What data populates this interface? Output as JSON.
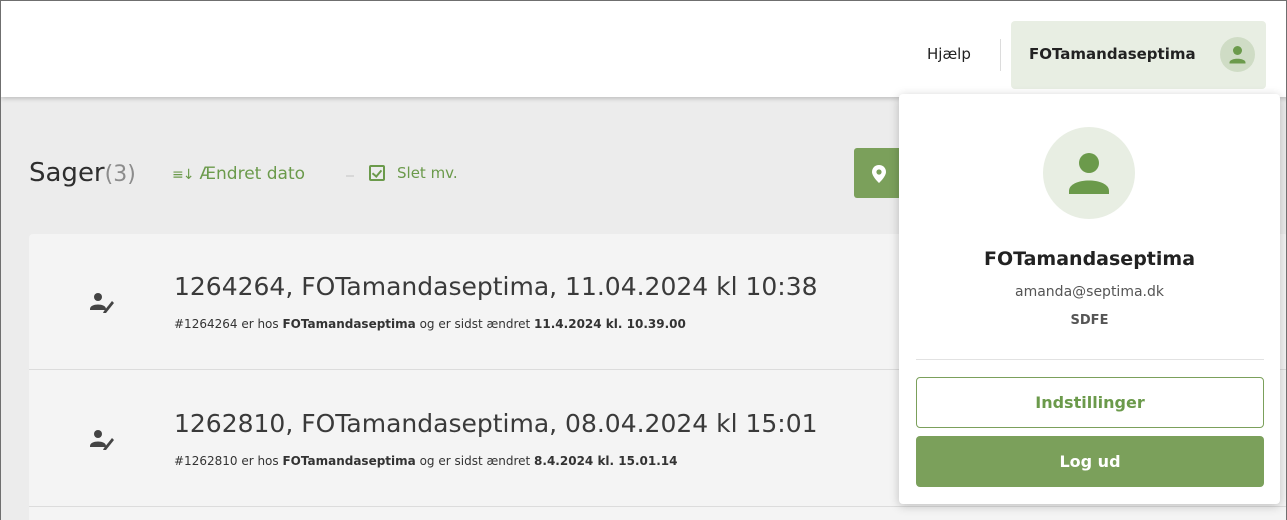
{
  "header": {
    "help_label": "Hjælp",
    "user_button_label": "FOTamandaseptima"
  },
  "toolbar": {
    "title": "Sager",
    "count": "(3)",
    "sort_label": "Ændret dato",
    "delete_label": "Slet mv."
  },
  "cases": [
    {
      "title": "1264264, FOTamandaseptima, 11.04.2024 kl 10:38",
      "sub_prefix": "#1264264 er hos ",
      "sub_user": "FOTamandaseptima",
      "sub_mid": " og er sidst ændret ",
      "sub_date": "11.4.2024 kl. 10.39.00"
    },
    {
      "title": "1262810, FOTamandaseptima, 08.04.2024 kl 15:01",
      "sub_prefix": "#1262810 er hos ",
      "sub_user": "FOTamandaseptima",
      "sub_mid": " og er sidst ændret ",
      "sub_date": "8.4.2024 kl. 15.01.14"
    }
  ],
  "user_menu": {
    "name": "FOTamandaseptima",
    "email": "amanda@septima.dk",
    "organization": "SDFE",
    "settings_label": "Indstillinger",
    "logout_label": "Log ud"
  },
  "colors": {
    "accent": "#7ba05b",
    "accent_text": "#6b9a4b",
    "avatar_bg": "#e8eee3"
  }
}
